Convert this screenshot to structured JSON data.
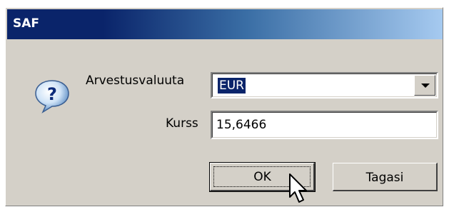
{
  "window": {
    "title": "SAF"
  },
  "icons": {
    "dialog": "question-icon",
    "pointer": "mouse-cursor-icon"
  },
  "form": {
    "currency_label": "Arvestusvaluuta",
    "currency_value": "EUR",
    "rate_label": "Kurss",
    "rate_value": "15,6466"
  },
  "buttons": {
    "ok_label": "OK",
    "cancel_label": "Tagasi"
  },
  "colors": {
    "title_bar_start": "#0a246a",
    "title_bar_end": "#a6caf0",
    "dialog_bg": "#d4d0c8",
    "selection": "#0a246a"
  }
}
